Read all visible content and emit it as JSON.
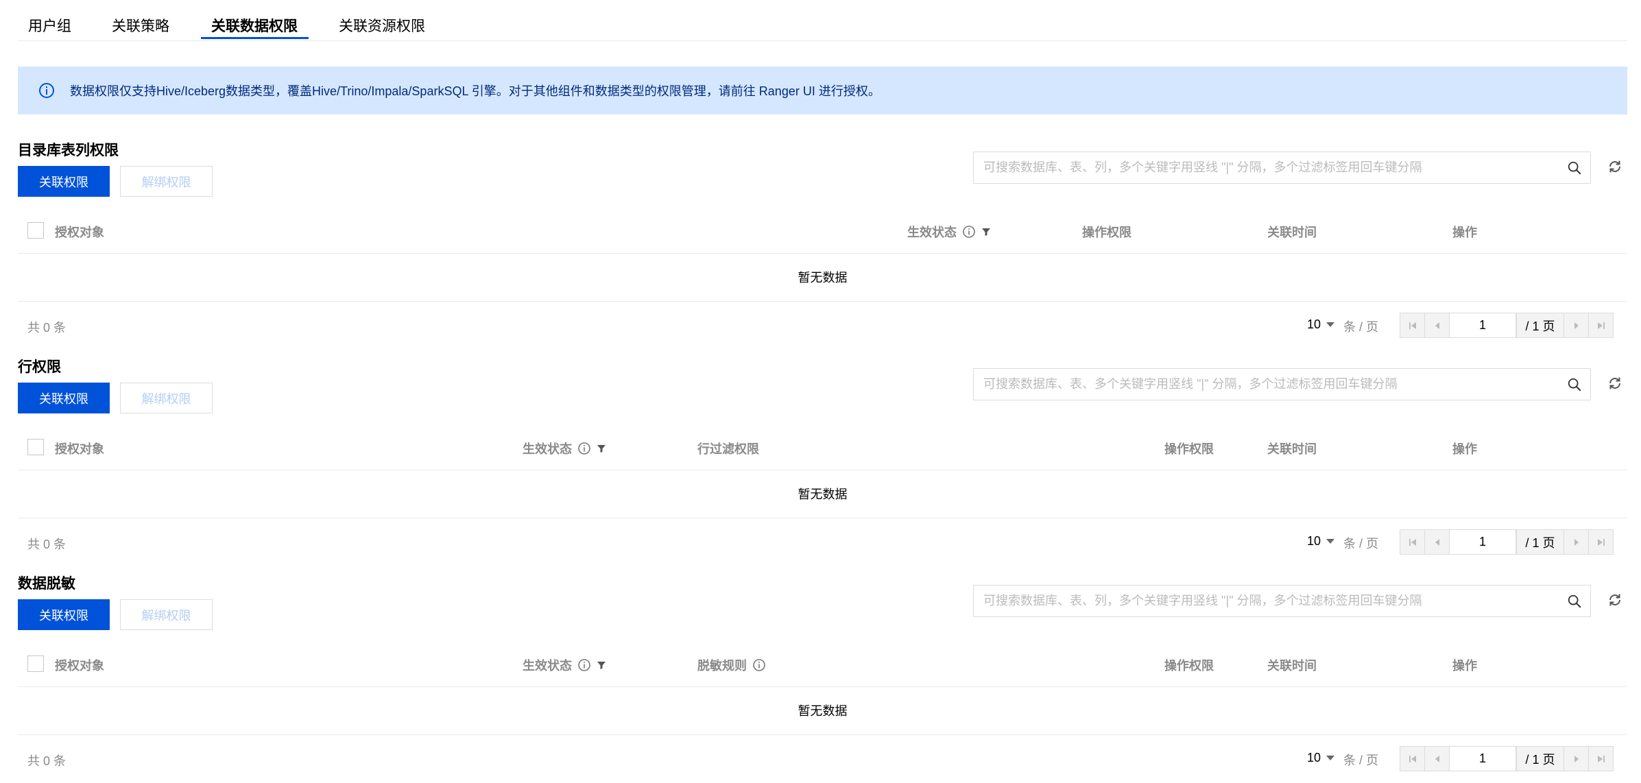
{
  "tabs": [
    {
      "label": "用户组",
      "active": false
    },
    {
      "label": "关联策略",
      "active": false
    },
    {
      "label": "关联数据权限",
      "active": true
    },
    {
      "label": "关联资源权限",
      "active": false
    }
  ],
  "notice": {
    "text": "数据权限仅支持Hive/Iceberg数据类型，覆盖Hive/Trino/Impala/SparkSQL 引擎。对于其他组件和数据类型的权限管理，请前往 Ranger UI 进行授权。",
    "color": "#002a7c",
    "background": "#d5e7ff"
  },
  "colors": {
    "primary": "#0052d9",
    "disabled_text": "#b4cef5",
    "muted": "#8a8a8a"
  },
  "sections": [
    {
      "title": "目录库表列权限",
      "bind_label": "关联权限",
      "unbind_label": "解绑权限",
      "search_placeholder": "可搜索数据库、表、列，多个关键字用竖线 \"|\" 分隔，多个过滤标签用回车键分隔",
      "columns": [
        "授权对象",
        "生效状态",
        "操作权限",
        "关联时间",
        "操作"
      ],
      "empty_text": "暂无数据",
      "total_text": "共 0 条",
      "page_size": "10",
      "per_page_text": "条 / 页",
      "current_page": "1",
      "total_pages_text": "/ 1 页"
    },
    {
      "title": "行权限",
      "bind_label": "关联权限",
      "unbind_label": "解绑权限",
      "search_placeholder": "可搜索数据库、表、多个关键字用竖线 \"|\" 分隔，多个过滤标签用回车键分隔",
      "columns": [
        "授权对象",
        "生效状态",
        "行过滤权限",
        "操作权限",
        "关联时间",
        "操作"
      ],
      "empty_text": "暂无数据",
      "total_text": "共 0 条",
      "page_size": "10",
      "per_page_text": "条 / 页",
      "current_page": "1",
      "total_pages_text": "/ 1 页"
    },
    {
      "title": "数据脱敏",
      "bind_label": "关联权限",
      "unbind_label": "解绑权限",
      "search_placeholder": "可搜索数据库、表、列，多个关键字用竖线 \"|\" 分隔，多个过滤标签用回车键分隔",
      "columns": [
        "授权对象",
        "生效状态",
        "脱敏规则",
        "操作权限",
        "关联时间",
        "操作"
      ],
      "empty_text": "暂无数据",
      "total_text": "共 0 条",
      "page_size": "10",
      "per_page_text": "条 / 页",
      "current_page": "1",
      "total_pages_text": "/ 1 页"
    }
  ]
}
